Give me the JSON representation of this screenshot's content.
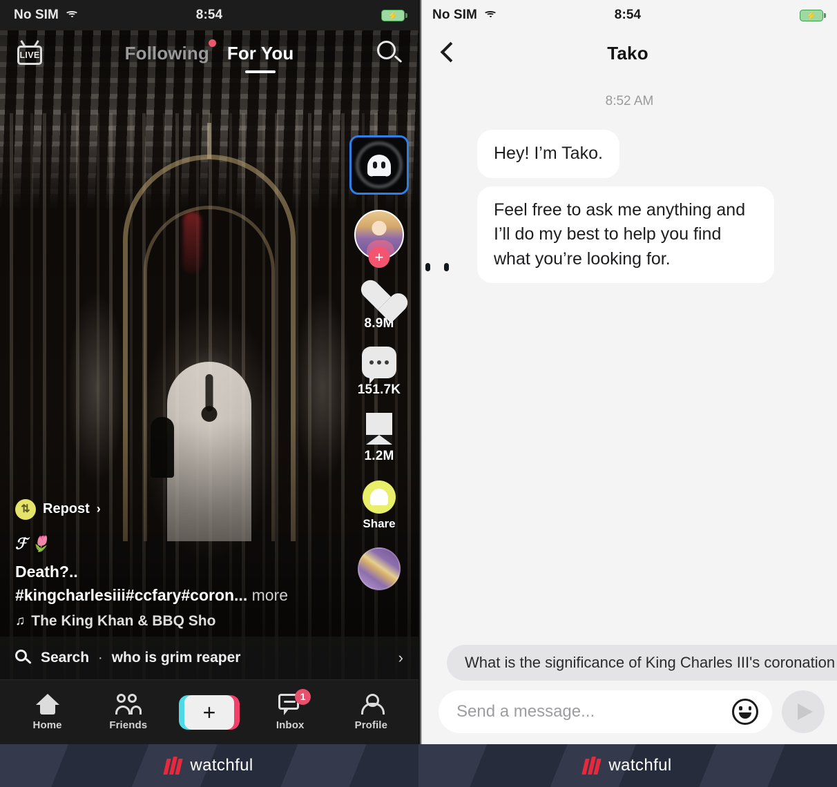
{
  "left_panel": {
    "status_bar": {
      "carrier": "No SIM",
      "time": "8:54",
      "wifi_icon": "wifi-icon",
      "battery_icon": "battery-charging-icon"
    },
    "header": {
      "live_label": "LIVE",
      "tabs": [
        {
          "label": "Following",
          "active": false,
          "has_dot": true
        },
        {
          "label": "For You",
          "active": true,
          "has_dot": false
        }
      ],
      "search_icon": "search-icon"
    },
    "rail": {
      "tako_button_icon": "tako-ghost-icon",
      "follow_plus": "+",
      "like_count": "8.9M",
      "comment_count": "151.7K",
      "bookmark_count": "1.2M",
      "share_label": "Share",
      "share_icon": "snapchat-icon",
      "music_disc_icon": "music-disc-icon"
    },
    "caption": {
      "repost_label": "Repost",
      "repost_chevron": "›",
      "handle": "ℱ 🌷",
      "line1": "Death?..",
      "hashtags": "#kingcharlesiii#ccfary#coron...",
      "more_label": "more",
      "music_note": "♫",
      "music_title": "The King Khan & BBQ Sho"
    },
    "search_suggestion": {
      "icon": "search-icon",
      "label": "Search",
      "separator": "·",
      "query": "who is grim reaper",
      "chevron": "›"
    },
    "bottom_nav": [
      {
        "label": "Home",
        "icon": "home-icon",
        "badge": null
      },
      {
        "label": "Friends",
        "icon": "friends-icon",
        "badge": null
      },
      {
        "label": "",
        "icon": "create-plus-icon",
        "badge": null,
        "plus": "+"
      },
      {
        "label": "Inbox",
        "icon": "inbox-icon",
        "badge": "1"
      },
      {
        "label": "Profile",
        "icon": "profile-icon",
        "badge": null
      }
    ]
  },
  "right_panel": {
    "status_bar": {
      "carrier": "No SIM",
      "time": "8:54",
      "wifi_icon": "wifi-icon",
      "battery_icon": "battery-charging-icon"
    },
    "header": {
      "back_icon": "back-chevron-icon",
      "title": "Tako"
    },
    "conversation": {
      "timestamp": "8:52 AM",
      "messages": [
        {
          "sender": "Tako",
          "text": "Hey! I’m Tako.",
          "show_avatar": false
        },
        {
          "sender": "Tako",
          "text": "Feel free to ask me anything and I’ll do my best to help you find what you’re looking for.",
          "show_avatar": true
        }
      ]
    },
    "suggestion_chip": "What is the significance of King Charles III's coronation",
    "composer": {
      "placeholder": "Send a message...",
      "value": "",
      "emoji_icon": "emoji-smiley-icon",
      "send_icon": "send-paper-plane-icon"
    }
  },
  "watermark": {
    "text": "watchful",
    "accent_color": "#e8283c",
    "bar_color": "#2b3143"
  }
}
